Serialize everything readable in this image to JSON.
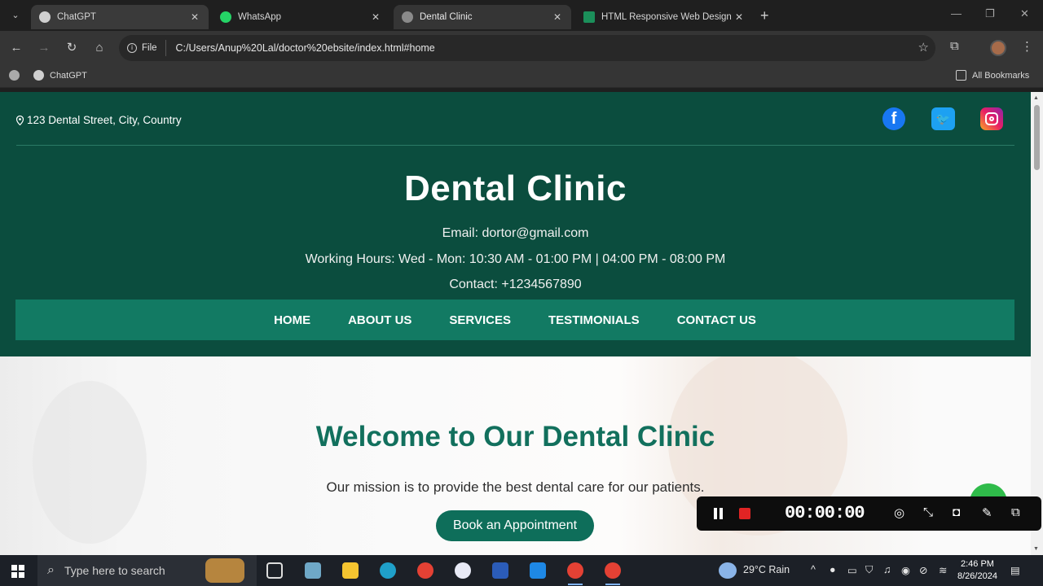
{
  "browser": {
    "tabs": [
      {
        "title": "ChatGPT",
        "favicon_color": "#cfcfcf"
      },
      {
        "title": "WhatsApp",
        "favicon_color": "#25d366"
      },
      {
        "title": "Dental Clinic",
        "favicon_color": "#8a8a8a"
      },
      {
        "title": "HTML Responsive Web Design",
        "favicon_color": "#1b8f5a"
      }
    ],
    "new_tab_icon": "+",
    "address": {
      "scheme_label": "File",
      "url": "C:/Users/Anup%20Lal/doctor%20ebsite/index.html#home"
    },
    "bookmarks": [
      {
        "label": "ChatGPT"
      }
    ],
    "all_bookmarks_label": "All Bookmarks"
  },
  "site": {
    "address": "123 Dental Street, City, Country",
    "title": "Dental Clinic",
    "email_line": "Email: dortor@gmail.com",
    "hours_line": "Working Hours: Wed - Mon: 10:30 AM - 01:00 PM | 04:00 PM - 08:00 PM",
    "contact_line": "Contact: +1234567890",
    "nav": [
      "HOME",
      "ABOUT US",
      "SERVICES",
      "TESTIMONIALS",
      "CONTACT US"
    ],
    "social": {
      "facebook_glyph": "f",
      "twitter_glyph": "🐦"
    },
    "hero": {
      "title": "Welcome to Our Dental Clinic",
      "text": "Our mission is to provide the best dental care for our patients.",
      "cta": "Book an Appointment"
    }
  },
  "recorder": {
    "time": "00:00:00"
  },
  "taskbar": {
    "search_placeholder": "Type here to search",
    "weather": "29°C  Rain",
    "time": "2:46 PM",
    "date": "8/26/2024"
  },
  "colors": {
    "header_bg": "#0b4d3e",
    "nav_bg": "#127a63",
    "accent_green": "#12705d"
  }
}
